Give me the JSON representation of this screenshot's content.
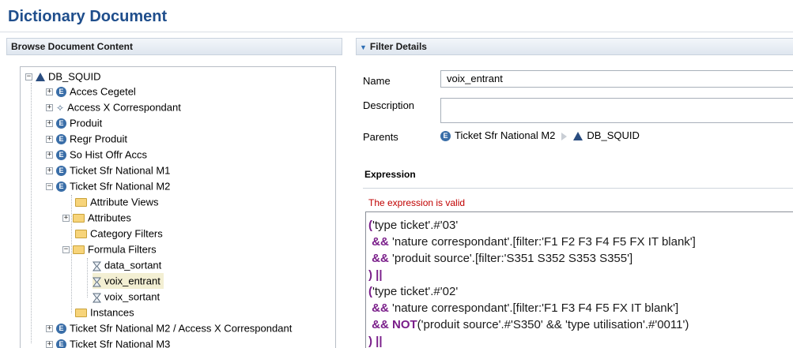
{
  "page": {
    "title": "Dictionary Document"
  },
  "left_panel": {
    "header": "Browse Document Content"
  },
  "tree": {
    "root": "DB_SQUID",
    "items": [
      "Acces Cegetel",
      "Access X Correspondant",
      "Produit",
      "Regr Produit",
      "So Hist Offr Accs",
      "Ticket Sfr National M1",
      "Ticket Sfr National M2",
      "Attribute Views",
      "Attributes",
      "Category Filters",
      "Formula Filters",
      "data_sortant",
      "voix_entrant",
      "voix_sortant",
      "Instances",
      "Ticket Sfr National M2 / Access X Correspondant",
      "Ticket Sfr National M3"
    ]
  },
  "right_panel": {
    "header": "Filter Details"
  },
  "form": {
    "name_label": "Name",
    "name_value": "voix_entrant",
    "description_label": "Description",
    "description_value": "",
    "parents_label": "Parents",
    "parent_1": "Ticket Sfr National M2",
    "parent_2": "DB_SQUID"
  },
  "expression": {
    "title": "Expression",
    "status": "The expression is valid",
    "lines": {
      "l1": "('type ticket'.#'03'",
      "l2_op": " && ",
      "l2": "'nature correspondant'.[filter:'F1 F2 F3 F4 F5 FX IT blank']",
      "l3_op": " && ",
      "l3": "'produit source'.[filter:'S351 S352 S353 S355']",
      "l4": ") ||",
      "l5": "('type ticket'.#'02'",
      "l6_op": " && ",
      "l6": "'nature correspondant'.[filter:'F1 F3 F4 F5 FX IT blank']",
      "l7_op": " && ",
      "l7_kw": "NOT",
      "l7": "('produit source'.#'S350' && 'type utilisation'.#'0011')",
      "l8": ") ||"
    }
  },
  "colors": {
    "title": "#1f4e8c",
    "valid_text": "#c00000",
    "keyword": "#7a1e8a",
    "selected_row": "#f3efd3"
  }
}
